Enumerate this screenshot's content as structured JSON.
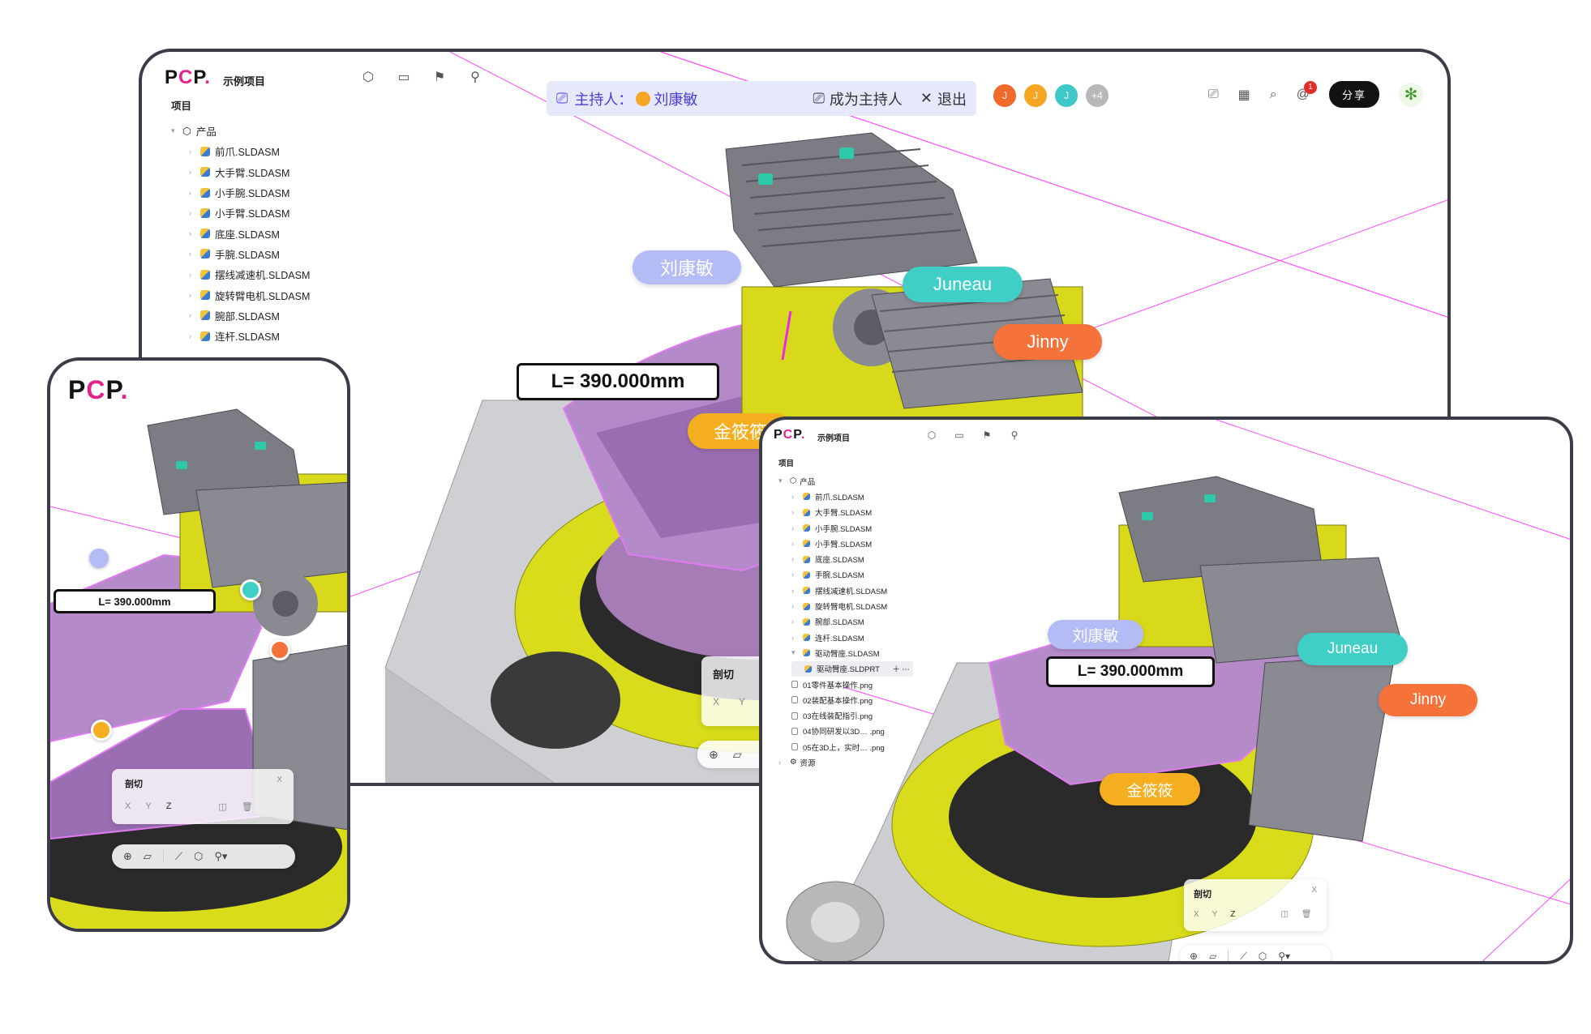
{
  "brand": {
    "logo_p1": "P",
    "logo_c": "C",
    "logo_p2": "P",
    "logo_dot": ".",
    "accent": "#e8208b"
  },
  "header": {
    "project_name": "示例项目",
    "host_label": "主持人：",
    "host_name": "刘康敏",
    "become_host": "成为主持人",
    "exit": "退出",
    "share": "分享",
    "notification_count": "1",
    "avatars": [
      {
        "letter": "J",
        "color": "#f06a2c"
      },
      {
        "letter": "J",
        "color": "#f5a623"
      },
      {
        "letter": "J",
        "color": "#3fc8c8"
      },
      {
        "letter": "+4",
        "color": "#b8b8b8"
      }
    ]
  },
  "tree": {
    "header": "项目",
    "root": "产品",
    "items": [
      "前爪.SLDASM",
      "大手臂.SLDASM",
      "小手腕.SLDASM",
      "小手臂.SLDASM",
      "底座.SLDASM",
      "手腕.SLDASM",
      "摆线减速机.SLDASM",
      "旋转臂电机.SLDASM",
      "腕部.SLDASM",
      "连杆.SLDASM"
    ],
    "tablet_extra": {
      "expanded": "驱动臂座.SLDASM",
      "child": "驱动臂座.SLDPRT",
      "files": [
        "01零件基本操作.png",
        "02装配基本操作.png",
        "03在线装配指引.png",
        "04协同研发以3D… .png",
        "05在3D上，实时… .png"
      ],
      "resources": "资源"
    }
  },
  "collaborators": {
    "liu": {
      "name": "刘康敏",
      "color": "#a9b4f5"
    },
    "juneau": {
      "name": "Juneau",
      "color": "#3fcfc7"
    },
    "jinny": {
      "name": "Jinny",
      "color": "#f5723a"
    },
    "jin": {
      "name": "金筱筱",
      "color": "#f5ae1f"
    }
  },
  "measurement": "L= 390.000mm",
  "section": {
    "title": "剖切",
    "x": "X",
    "y": "Y",
    "z": "Z",
    "close": "X"
  },
  "icons": [
    "cube-icon",
    "comment-icon",
    "flag-icon",
    "bulb-icon",
    "present-icon",
    "grid-icon",
    "search-icon",
    "at-icon",
    "leaf-icon"
  ]
}
